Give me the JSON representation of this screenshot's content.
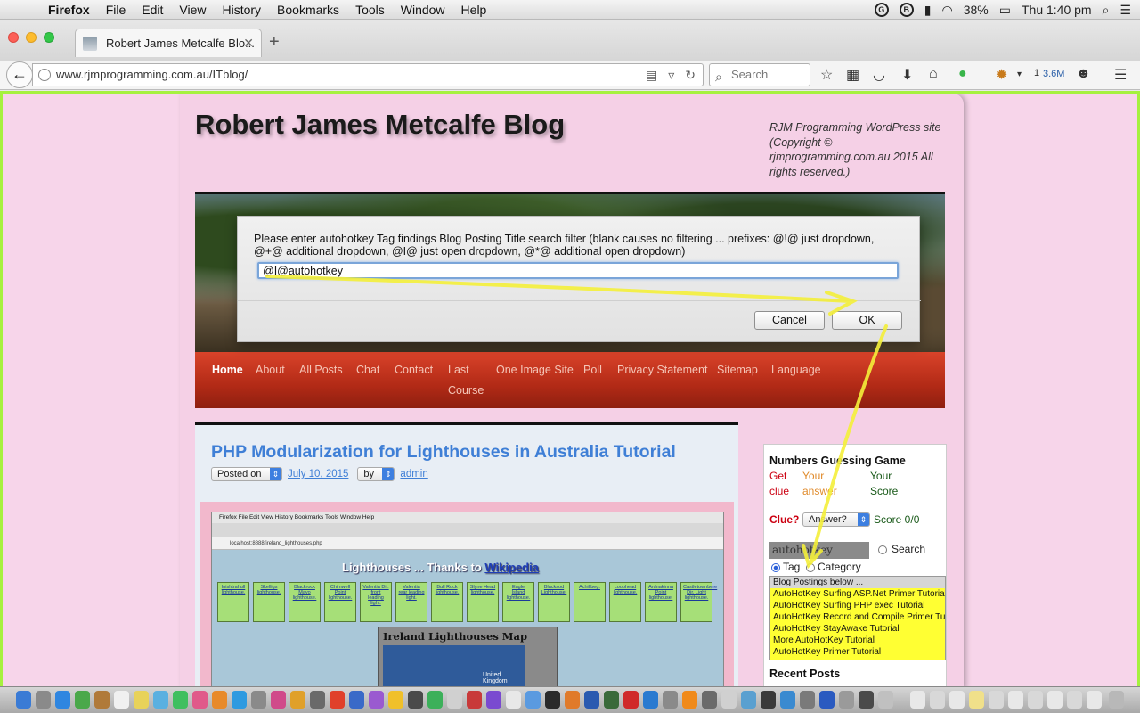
{
  "menubar": {
    "app_name": "Firefox",
    "menus": [
      "File",
      "Edit",
      "View",
      "History",
      "Bookmarks",
      "Tools",
      "Window",
      "Help"
    ],
    "battery": "38%",
    "clock": "Thu 1:40 pm"
  },
  "browser": {
    "tab_title": "Robert James Metcalfe Blo...",
    "url": "www.rjmprogramming.com.au/ITblog/",
    "search_placeholder": "Search",
    "toolbar_badge": "1",
    "toolbar_size": "3.6M"
  },
  "site": {
    "title": "Robert James Metcalfe Blog",
    "description": "RJM Programming WordPress site (Copyright © rjmprogramming.com.au 2015 All rights reserved.)"
  },
  "dialog": {
    "message": "Please enter autohotkey Tag findings Blog Posting Title search filter (blank causes no filtering ... prefixes: @!@ just dropdown, @+@ additional dropdown, @I@ just open dropdown, @*@ additional open dropdown)",
    "input_value": "@I@autohotkey",
    "cancel_label": "Cancel",
    "ok_label": "OK"
  },
  "nav": {
    "home": "Home",
    "about": "About",
    "all_posts": "All Posts",
    "chat": "Chat",
    "contact": "Contact",
    "last_course_1": "Last",
    "last_course_2": "Course",
    "one_image": "One Image Site",
    "poll": "Poll",
    "privacy": "Privacy Statement",
    "sitemap": "Sitemap",
    "language": "Language"
  },
  "post": {
    "title": "PHP Modularization for Lighthouses in Australia Tutorial",
    "posted_on": "Posted on",
    "date": "July 10, 2015",
    "by": "by",
    "author": "admin",
    "screenshot": {
      "menus": "Firefox   File   Edit   View   History   Bookmarks   Tools   Window   Help",
      "url": "localhost:8888/ireland_lighthouses.php",
      "heading": "Lighthouses ... Thanks to ",
      "heading_link": "Wikipedia",
      "cells": [
        "Inishtrahull lighthouse.",
        "Skelligs lighthouse.",
        "Blackrock Mayo lighthouse.",
        "Chimwell Point lighthouse.",
        "Valentia Dir. front leading light.",
        "Valentia rear leading light.",
        "Bull Rock lighthouse.",
        "Slyne Head lighthouse.",
        "Eagle Island lighthouse.",
        "Blacksod Lighthouse.",
        "Achillbeg.",
        "Loophead lighthouse.",
        "Ardnakinna Point lighthouse.",
        "Castletownbere Dir. Light lighthouse."
      ],
      "map_title": "Ireland Lighthouses Map",
      "map_label": "United Kingdom"
    }
  },
  "sidebar": {
    "game_title": "Numbers Guessing Game",
    "get_clue": "Get clue",
    "your_answer": "Your answer",
    "your_score": "Your Score",
    "clue_label": "Clue?",
    "answer_select": "Answer?",
    "score": "Score 0/0",
    "tag_input": "autohotkey",
    "search_label": "Search",
    "tag_label": "Tag",
    "category_label": "Category",
    "list_header": "Blog Postings below ...",
    "list_items": [
      "AutoHotKey Surfing ASP.Net Primer Tutorial",
      "AutoHotKey Surfing PHP exec Tutorial",
      "AutoHotKey Record and Compile Primer Tutorial",
      "AutoHotKey StayAwake Tutorial",
      "More AutoHotKey Tutorial",
      "AutoHotKey Primer Tutorial"
    ],
    "recent_posts": "Recent Posts"
  },
  "colors": {
    "highlight_border": "#a6f13f",
    "annotation_arrow": "#f4ef3a",
    "nav_red": "#c0321c",
    "link_blue": "#3f7fd6"
  }
}
